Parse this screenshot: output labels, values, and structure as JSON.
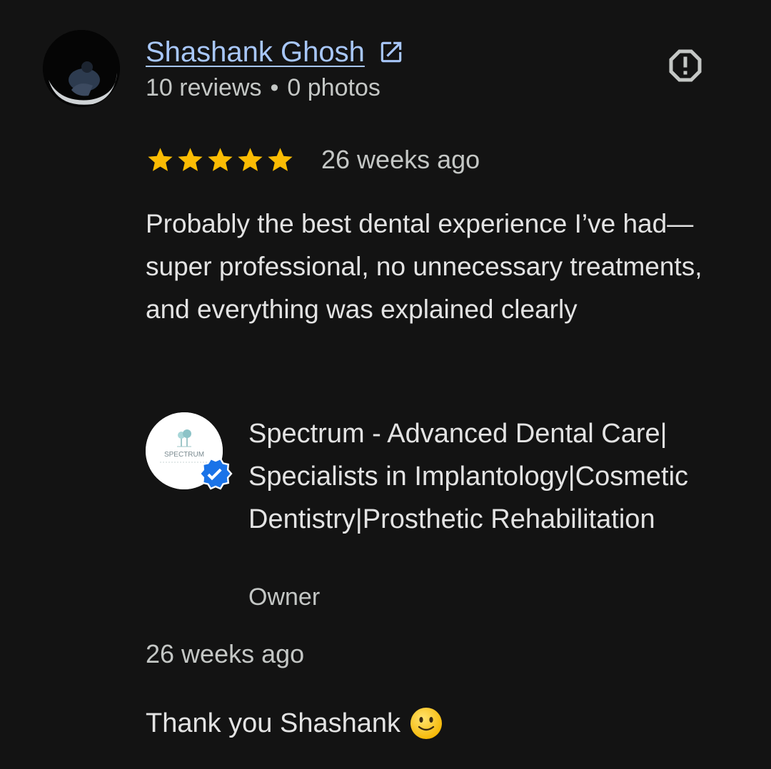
{
  "reviewer": {
    "name": "Shashank Ghosh",
    "reviews": "10 reviews",
    "separator": "•",
    "photos": "0 photos",
    "avatar_icon": "user-photo-avatar",
    "link_icon": "open-in-new-icon",
    "report_icon": "report-flag-icon"
  },
  "review": {
    "rating": 5,
    "rating_max": 5,
    "star_color": "#fbbc04",
    "time": "26 weeks ago",
    "text": "Probably the best dental experience I’ve had—super professional, no unnecessary treatments, and everything was explained clearly"
  },
  "owner": {
    "name": "Spectrum - Advanced Dental Care| Specialists in Implantology|Cosmetic Dentistry|Prosthetic Rehabilitation",
    "role": "Owner",
    "logo_text": "SPECTRUM",
    "verified_color": "#1a73e8",
    "response_time": "26 weeks ago",
    "response_text": "Thank you Shashank",
    "response_emoji": "slightly-smiling-face-icon"
  },
  "colors": {
    "background": "#131313",
    "link": "#a8c7fa",
    "primary_text": "#e3e3e3",
    "secondary_text": "#c4c7c5"
  }
}
